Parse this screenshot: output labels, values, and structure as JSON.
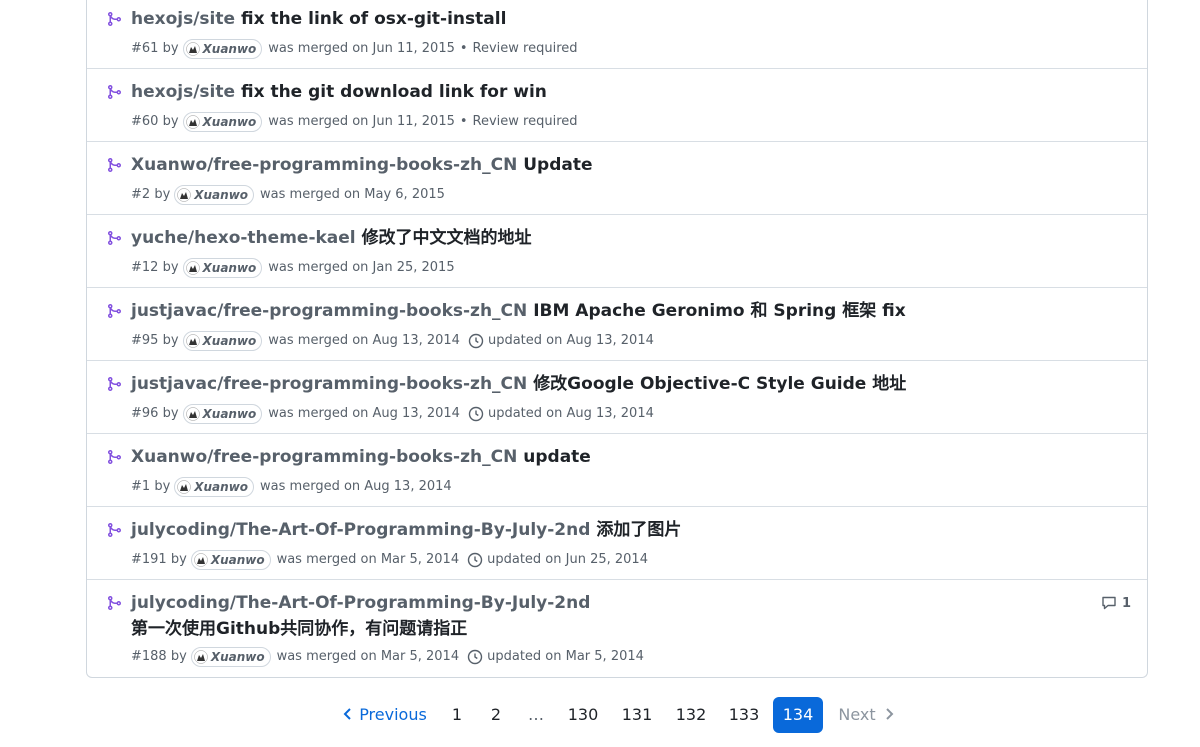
{
  "items": [
    {
      "repo": "hexojs/site",
      "title": "fix the link of osx-git-install",
      "title2": "",
      "number": "#61",
      "by": "by",
      "author": "Xuanwo",
      "merged": "was merged on Jun 11, 2015",
      "sep": "•",
      "extra": "Review required",
      "updated": "",
      "comments": ""
    },
    {
      "repo": "hexojs/site",
      "title": "fix the git download link for win",
      "title2": "",
      "number": "#60",
      "by": "by",
      "author": "Xuanwo",
      "merged": "was merged on Jun 11, 2015",
      "sep": "•",
      "extra": "Review required",
      "updated": "",
      "comments": ""
    },
    {
      "repo": "Xuanwo/free-programming-books-zh_CN",
      "title": "Update",
      "title2": "",
      "number": "#2",
      "by": "by",
      "author": "Xuanwo",
      "merged": "was merged on May 6, 2015",
      "sep": "",
      "extra": "",
      "updated": "",
      "comments": ""
    },
    {
      "repo": "yuche/hexo-theme-kael",
      "title": "修改了中文文档的地址",
      "title2": "",
      "number": "#12",
      "by": "by",
      "author": "Xuanwo",
      "merged": "was merged on Jan 25, 2015",
      "sep": "",
      "extra": "",
      "updated": "",
      "comments": ""
    },
    {
      "repo": "justjavac/free-programming-books-zh_CN",
      "title": "IBM Apache Geronimo 和 Spring 框架 fix",
      "title2": "",
      "number": "#95",
      "by": "by",
      "author": "Xuanwo",
      "merged": "was merged on Aug 13, 2014",
      "sep": "",
      "extra": "",
      "updated": "updated on Aug 13, 2014",
      "comments": ""
    },
    {
      "repo": "justjavac/free-programming-books-zh_CN",
      "title": "修改Google Objective-C Style Guide 地址",
      "title2": "",
      "number": "#96",
      "by": "by",
      "author": "Xuanwo",
      "merged": "was merged on Aug 13, 2014",
      "sep": "",
      "extra": "",
      "updated": "updated on Aug 13, 2014",
      "comments": ""
    },
    {
      "repo": "Xuanwo/free-programming-books-zh_CN",
      "title": "update",
      "title2": "",
      "number": "#1",
      "by": "by",
      "author": "Xuanwo",
      "merged": "was merged on Aug 13, 2014",
      "sep": "",
      "extra": "",
      "updated": "",
      "comments": ""
    },
    {
      "repo": "julycoding/The-Art-Of-Programming-By-July-2nd",
      "title": "添加了图片",
      "title2": "",
      "number": "#191",
      "by": "by",
      "author": "Xuanwo",
      "merged": "was merged on Mar 5, 2014",
      "sep": "",
      "extra": "",
      "updated": "updated on Jun 25, 2014",
      "comments": ""
    },
    {
      "repo": "julycoding/The-Art-Of-Programming-By-July-2nd",
      "title": "",
      "title2": "第一次使用Github共同协作，有问题请指正",
      "number": "#188",
      "by": "by",
      "author": "Xuanwo",
      "merged": "was merged on Mar 5, 2014",
      "sep": "",
      "extra": "",
      "updated": "updated on Mar 5, 2014",
      "comments": "1"
    }
  ],
  "pagination": {
    "previous": "Previous",
    "next": "Next",
    "pages": [
      "1",
      "2",
      "…",
      "130",
      "131",
      "132",
      "133",
      "134"
    ],
    "current": "134"
  },
  "colors": {
    "accent": "#0969da",
    "merged": "#8250df",
    "muted": "#57606a"
  }
}
